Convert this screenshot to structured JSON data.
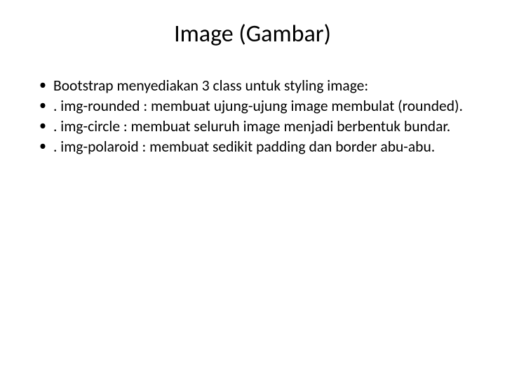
{
  "title": "Image (Gambar)",
  "bullets": [
    "Bootstrap menyediakan 3 class untuk styling image:",
    ". img-rounded : membuat ujung-ujung image membulat (rounded).",
    ". img-circle : membuat seluruh image menjadi berbentuk bundar.",
    ". img-polaroid : membuat sedikit padding dan border abu-abu."
  ]
}
